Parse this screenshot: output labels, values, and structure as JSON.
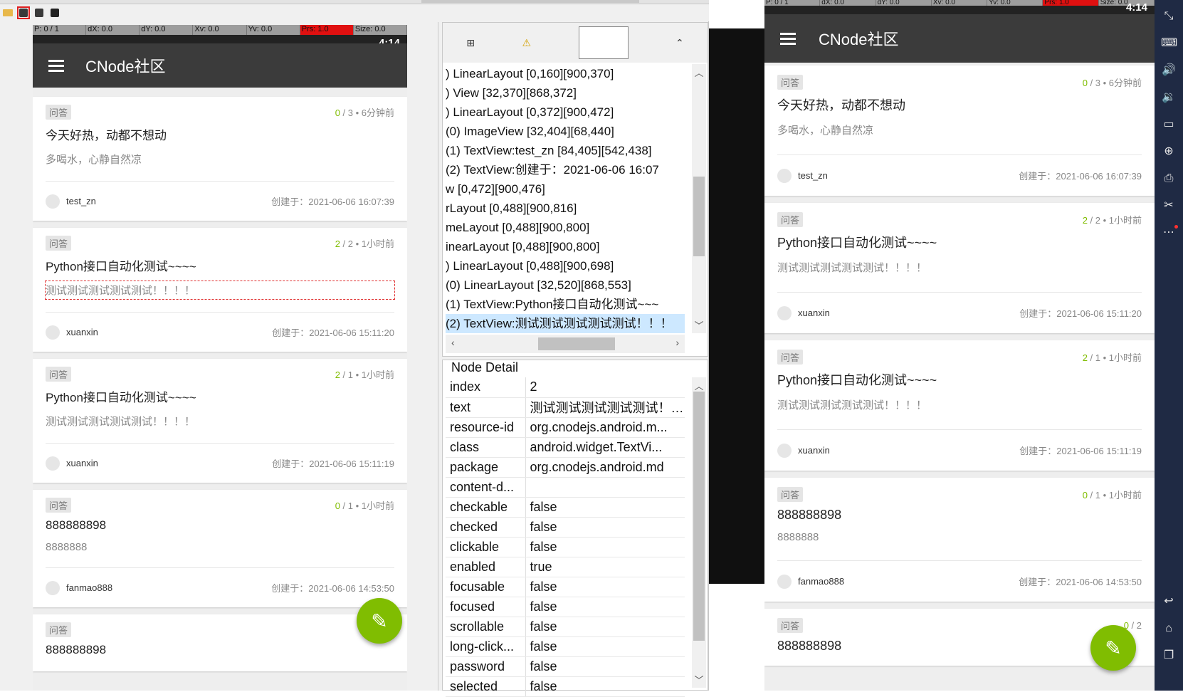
{
  "toolbar": {
    "icons": [
      "open-folder-icon",
      "screenshot-icon",
      "screenshot-compressed-icon",
      "save-icon"
    ]
  },
  "pointer_bar": {
    "p": "P: 0 / 1",
    "dx": "dX: 0.0",
    "dy": "dY: 0.0",
    "xv": "Xv: 0.0",
    "yv": "Yv: 0.0",
    "prs": "Prs: 1.0",
    "size": "Size: 0.0"
  },
  "pointer_bar_right": {
    "p": "P: 0 / 1",
    "dx": "dX: 0.0",
    "dy": "dY: 0.0",
    "xv": "Xv: 0.0",
    "yv": "Yv: 0.0",
    "prs": "Prs: 1.0",
    "size": "Size: 0.0"
  },
  "status": {
    "clock": "4:14"
  },
  "app": {
    "title": "CNode社区"
  },
  "left_cards": [
    {
      "tag": "问答",
      "cnt": "0",
      "meta": " / 3 • 6分钟前",
      "title": "今天好热，动都不想动",
      "summary": "多喝水，心静自然凉",
      "author": "test_zn",
      "created": "创建于：2021-06-06 16:07:39"
    },
    {
      "tag": "问答",
      "cnt": "2",
      "meta": " / 2 • 1小时前",
      "title": "Python接口自动化测试~~~~",
      "summary": "测试测试测试测试测试！！！！",
      "author": "xuanxin",
      "created": "创建于：2021-06-06 15:11:20"
    },
    {
      "tag": "问答",
      "cnt": "2",
      "meta": " / 1 • 1小时前",
      "title": "Python接口自动化测试~~~~",
      "summary": "测试测试测试测试测试！！！！",
      "author": "xuanxin",
      "created": "创建于：2021-06-06 15:11:19"
    },
    {
      "tag": "问答",
      "cnt": "0",
      "meta": " / 1 • 1小时前",
      "title": "888888898",
      "summary": "8888888",
      "author": "fanmao888",
      "created": "创建于：2021-06-06 14:53:50"
    },
    {
      "tag": "问答",
      "cnt": "0",
      "meta": " / 2",
      "title": "888888898"
    }
  ],
  "right_cards": [
    {
      "tag": "问答",
      "cnt": "0",
      "meta": " / 3 • 6分钟前",
      "title": "今天好热，动都不想动",
      "summary": "多喝水，心静自然凉",
      "author": "test_zn",
      "created": "创建于：2021-06-06 16:07:39"
    },
    {
      "tag": "问答",
      "cnt": "2",
      "meta": " / 2 • 1小时前",
      "title": "Python接口自动化测试~~~~",
      "summary": "测试测试测试测试测试！！！！",
      "author": "xuanxin",
      "created": "创建于：2021-06-06 15:11:20"
    },
    {
      "tag": "问答",
      "cnt": "2",
      "meta": " / 1 • 1小时前",
      "title": "Python接口自动化测试~~~~",
      "summary": "测试测试测试测试测试！！！！",
      "author": "xuanxin",
      "created": "创建于：2021-06-06 15:11:19"
    },
    {
      "tag": "问答",
      "cnt": "0",
      "meta": " / 1 • 1小时前",
      "title": "888888898",
      "summary": "8888888",
      "author": "fanmao888",
      "created": "创建于：2021-06-06 14:53:50"
    },
    {
      "tag": "问答",
      "cnt": "0",
      "meta": " / 2",
      "title": "888888898"
    }
  ],
  "tree": {
    "nodes": [
      ") LinearLayout [0,160][900,370]",
      ") View [32,370][868,372]",
      ") LinearLayout [0,372][900,472]",
      "(0) ImageView [32,404][68,440]",
      "(1) TextView:test_zn [84,405][542,438]",
      "(2) TextView:创建于：2021-06-06 16:07",
      "w [0,472][900,476]",
      "rLayout [0,488][900,816]",
      "meLayout [0,488][900,800]",
      "inearLayout [0,488][900,800]",
      ") LinearLayout [0,488][900,698]",
      "(0) LinearLayout [32,520][868,553]",
      "(1) TextView:Python接口自动化测试~~~",
      "(2) TextView:测试测试测试测试测试！！！"
    ],
    "selected_index": 13
  },
  "detail": {
    "title": "Node Detail",
    "rows": [
      {
        "k": "index",
        "v": "2"
      },
      {
        "k": "text",
        "v": "测试测试测试测试测试！…"
      },
      {
        "k": "resource-id",
        "v": "org.cnodejs.android.m..."
      },
      {
        "k": "class",
        "v": "android.widget.TextVi..."
      },
      {
        "k": "package",
        "v": "org.cnodejs.android.md"
      },
      {
        "k": "content-d...",
        "v": ""
      },
      {
        "k": "checkable",
        "v": "false"
      },
      {
        "k": "checked",
        "v": "false"
      },
      {
        "k": "clickable",
        "v": "false"
      },
      {
        "k": "enabled",
        "v": "true"
      },
      {
        "k": "focusable",
        "v": "false"
      },
      {
        "k": "focused",
        "v": "false"
      },
      {
        "k": "scrollable",
        "v": "false"
      },
      {
        "k": "long-click...",
        "v": "false"
      },
      {
        "k": "password",
        "v": "false"
      },
      {
        "k": "selected",
        "v": "false"
      }
    ]
  },
  "emulator_panel": {
    "icons": [
      "fullscreen-icon",
      "keyboard-icon",
      "volume-up-icon",
      "volume-down-icon",
      "screen-icon",
      "add-apk-icon",
      "print-icon",
      "scissors-icon",
      "more-icon",
      "back-icon",
      "home-icon",
      "recents-icon"
    ]
  },
  "colors": {
    "accent": "#80bd01",
    "appbar": "#3b3b3b",
    "emu_panel": "#1f2a44"
  }
}
